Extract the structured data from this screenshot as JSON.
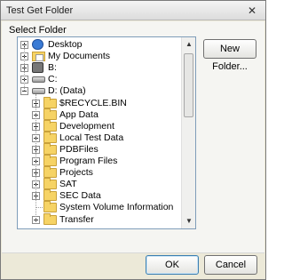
{
  "window": {
    "title": "Test Get Folder",
    "close_glyph": "✕"
  },
  "section_label": "Select Folder",
  "buttons": {
    "new_folder": "New Folder...",
    "ok": "OK",
    "cancel": "Cancel"
  },
  "tree": {
    "items": [
      {
        "label": "Desktop",
        "icon": "desktop-icon",
        "expander": "plus",
        "level": 0
      },
      {
        "label": "My Documents",
        "icon": "documents-folder-icon",
        "expander": "plus",
        "level": 0
      },
      {
        "label": "B:",
        "icon": "network-drive-icon",
        "expander": "plus",
        "level": 0
      },
      {
        "label": "C:",
        "icon": "drive-icon",
        "expander": "plus",
        "level": 0
      },
      {
        "label": "D: (Data)",
        "icon": "drive-icon",
        "expander": "minus",
        "level": 0
      },
      {
        "label": "$RECYCLE.BIN",
        "icon": "folder-icon",
        "expander": "plus",
        "level": 1
      },
      {
        "label": "App Data",
        "icon": "folder-icon",
        "expander": "plus",
        "level": 1
      },
      {
        "label": "Development",
        "icon": "folder-icon",
        "expander": "plus",
        "level": 1
      },
      {
        "label": "Local Test Data",
        "icon": "folder-icon",
        "expander": "plus",
        "level": 1
      },
      {
        "label": "PDBFiles",
        "icon": "folder-icon",
        "expander": "plus",
        "level": 1
      },
      {
        "label": "Program Files",
        "icon": "folder-icon",
        "expander": "plus",
        "level": 1
      },
      {
        "label": "Projects",
        "icon": "folder-icon",
        "expander": "plus",
        "level": 1
      },
      {
        "label": "SAT",
        "icon": "folder-icon",
        "expander": "plus",
        "level": 1
      },
      {
        "label": "SEC Data",
        "icon": "folder-icon",
        "expander": "plus",
        "level": 1
      },
      {
        "label": "System Volume Information",
        "icon": "folder-icon",
        "expander": "none",
        "level": 1
      },
      {
        "label": "Transfer",
        "icon": "folder-icon",
        "expander": "plus",
        "level": 1
      }
    ],
    "scrollbar": {
      "up_glyph": "▲",
      "down_glyph": "▼"
    }
  }
}
